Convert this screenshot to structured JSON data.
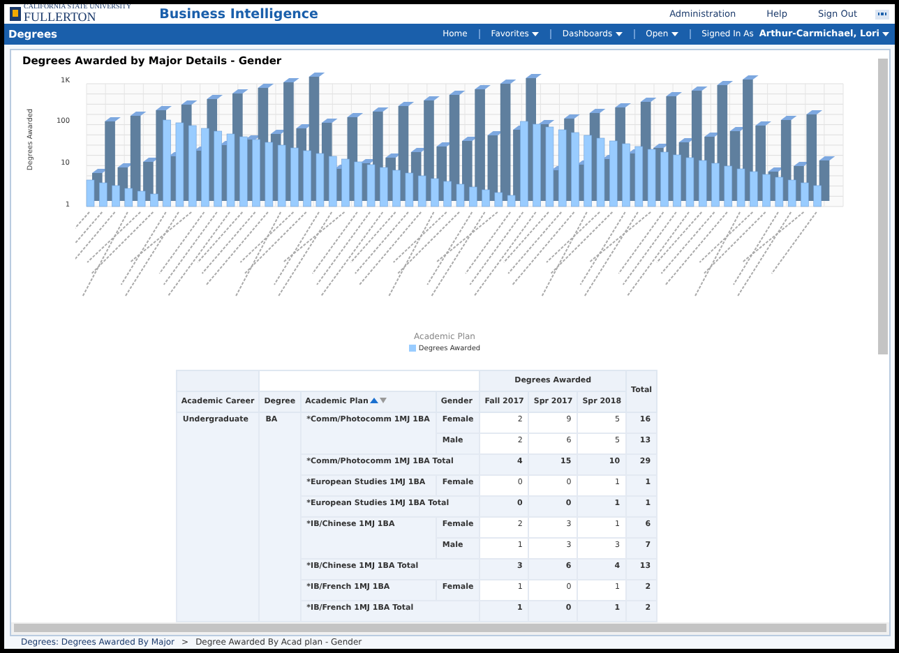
{
  "header": {
    "logo_top": "CALIFORNIA STATE UNIVERSITY",
    "logo_name": "FULLERTON",
    "app_title": "Business Intelligence",
    "links": [
      "Administration",
      "Help",
      "Sign Out"
    ]
  },
  "navbar": {
    "title": "Degrees",
    "items": [
      {
        "label": "Home",
        "caret": false
      },
      {
        "label": "Favorites",
        "caret": true
      },
      {
        "label": "Dashboards",
        "caret": true
      },
      {
        "label": "Open",
        "caret": true
      }
    ],
    "signed_in_label": "Signed In As",
    "user": "Arthur-Carmichael, Lori"
  },
  "report": {
    "title": "Degrees Awarded by Major Details - Gender",
    "chart": {
      "ylabel": "Degrees Awarded",
      "yticks": [
        "1K",
        "100",
        "10",
        "1"
      ],
      "xlabel": "Academic Plan",
      "legend": "Degrees Awarded"
    },
    "table": {
      "group_header": "Degrees Awarded",
      "columns": [
        {
          "label": "Academic Career",
          "sorted": false
        },
        {
          "label": "Degree",
          "sorted": false
        },
        {
          "label": "Academic Plan",
          "sorted": true
        },
        {
          "label": "Gender",
          "sorted": false
        }
      ],
      "terms": [
        "Fall 2017",
        "Spr 2017",
        "Spr 2018"
      ],
      "total_header": "Total",
      "career": "Undergraduate",
      "degree": "BA",
      "plans": [
        {
          "name": "*Comm/Photocomm 1MJ 1BA",
          "rows": [
            {
              "gender": "Female",
              "values": [
                "2",
                "9",
                "5"
              ],
              "total": "16"
            },
            {
              "gender": "Male",
              "values": [
                "2",
                "6",
                "5"
              ],
              "total": "13"
            }
          ],
          "total_label": "*Comm/Photocomm 1MJ 1BA Total",
          "totals": [
            "4",
            "15",
            "10"
          ],
          "total": "29"
        },
        {
          "name": "*European Studies 1MJ 1BA",
          "rows": [
            {
              "gender": "Female",
              "values": [
                "0",
                "0",
                "1"
              ],
              "total": "1"
            }
          ],
          "total_label": "*European Studies 1MJ 1BA Total",
          "totals": [
            "0",
            "0",
            "1"
          ],
          "total": "1"
        },
        {
          "name": "*IB/Chinese 1MJ 1BA",
          "rows": [
            {
              "gender": "Female",
              "values": [
                "2",
                "3",
                "1"
              ],
              "total": "6"
            },
            {
              "gender": "Male",
              "values": [
                "1",
                "3",
                "3"
              ],
              "total": "7"
            }
          ],
          "total_label": "*IB/Chinese 1MJ 1BA Total",
          "totals": [
            "3",
            "6",
            "4"
          ],
          "total": "13"
        },
        {
          "name": "*IB/French 1MJ 1BA",
          "rows": [
            {
              "gender": "Female",
              "values": [
                "1",
                "0",
                "1"
              ],
              "total": "2"
            }
          ],
          "total_label": "*IB/French 1MJ 1BA Total",
          "totals": [
            "1",
            "0",
            "1"
          ],
          "total": "2"
        }
      ]
    }
  },
  "breadcrumb": {
    "link": "Degrees: Degrees Awarded By Major",
    "separator": ">",
    "current": "Degree Awarded By Acad plan - Gender"
  }
}
